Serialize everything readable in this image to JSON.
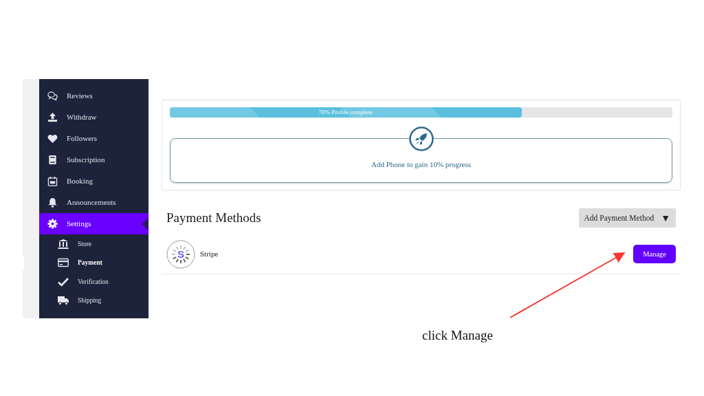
{
  "sidebar": {
    "items": [
      {
        "label": "Reviews",
        "selected": false
      },
      {
        "label": "Withdraw",
        "selected": false
      },
      {
        "label": "Followers",
        "selected": false
      },
      {
        "label": "Subscription",
        "selected": false
      },
      {
        "label": "Booking",
        "selected": false
      },
      {
        "label": "Announcements",
        "selected": false
      },
      {
        "label": "Settings",
        "selected": true,
        "children": [
          {
            "label": "Store",
            "selected": false
          },
          {
            "label": "Payment",
            "selected": true
          },
          {
            "label": "Verification",
            "selected": false
          },
          {
            "label": "Shipping",
            "selected": false
          }
        ]
      }
    ]
  },
  "profile_progress": {
    "level": 0.7,
    "label": "70% Profile complete",
    "hint": "Add Phone to gain 10% progress"
  },
  "payment_methods": {
    "title": "Payment Methods",
    "add_button": "Add Payment Method",
    "dropdown_caret": "▼",
    "methods": [
      {
        "name": "Stripe",
        "logo_letter": "S",
        "button": "Manage"
      }
    ]
  },
  "annotation": {
    "text": "click Manage"
  }
}
